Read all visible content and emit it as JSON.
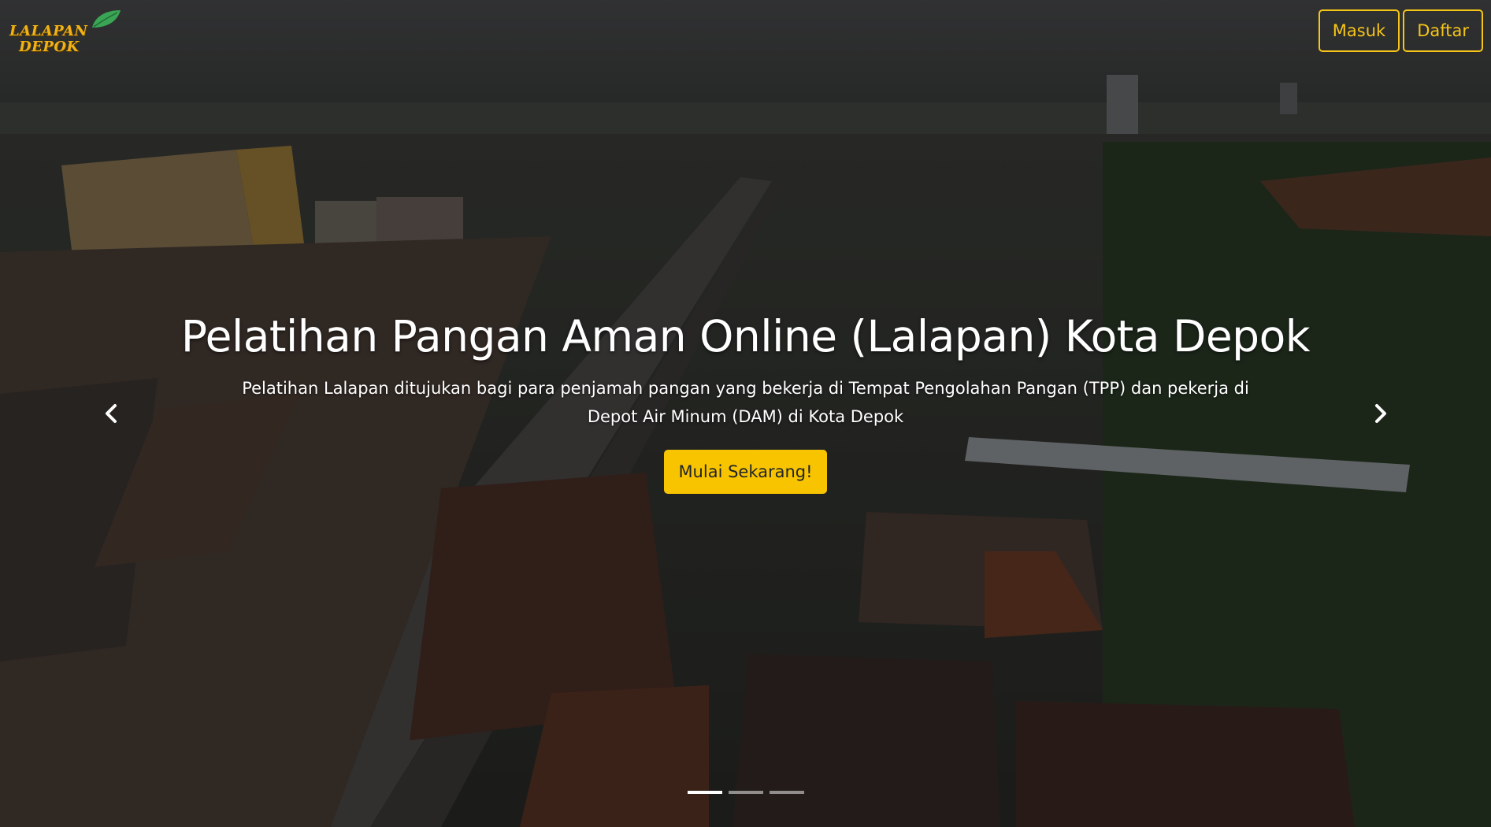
{
  "brand": {
    "line1": "LALAPAN",
    "line2": "DEPOK",
    "logo_color": "#f0b216",
    "leaf_color": "#3aa655"
  },
  "nav": {
    "login_label": "Masuk",
    "register_label": "Daftar",
    "button_color": "#f5c518"
  },
  "hero": {
    "title": "Pelatihan Pangan Aman Online (Lalapan) Kota Depok",
    "description": "Pelatihan Lalapan ditujukan bagi para penjamah pangan yang bekerja di Tempat Pengolahan Pangan (TPP) dan pekerja di Depot Air Minum (DAM) di Kota Depok",
    "cta_label": "Mulai Sekarang!",
    "cta_color": "#f8c400"
  },
  "carousel": {
    "prev_icon": "chevron-left-icon",
    "next_icon": "chevron-right-icon",
    "slide_count": 3,
    "active_index": 0
  }
}
